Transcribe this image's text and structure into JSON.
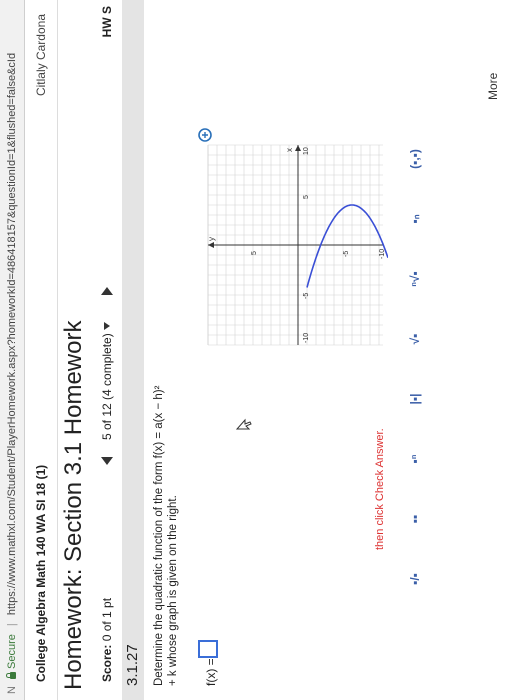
{
  "browser": {
    "secure_label": "Secure",
    "url": "https://www.mathxl.com/Student/PlayerHomework.aspx?homeworkId=48641815​7&questionId=1&flushed=false&cId"
  },
  "course": {
    "title": "College Algebra Math 140 WA SI 18 (1)",
    "user": "Citlaly Cardona"
  },
  "homework": {
    "title": "Homework: Section 3.1 Homework",
    "score_label": "Score:",
    "score_value": "0 of 1 pt",
    "progress": "5 of 12 (4 complete)",
    "right_label": "HW S"
  },
  "question": {
    "number": "3.1.27",
    "text": "Determine the quadratic function of the form f(x) = a(x − h)² + k whose graph is given on the right.",
    "answer_label": "f(x) ="
  },
  "graph": {
    "x_tick_labels": [
      "-10",
      "-5",
      "5",
      "10"
    ],
    "y_tick_labels": [
      "5",
      "-5",
      "-10"
    ],
    "x_axis_label": "x",
    "y_axis_label": "y",
    "curve_color": "#3a4fd6"
  },
  "footer": {
    "instruction": "then click Check Answer.",
    "more_label": "More"
  },
  "icons": [
    "lock-icon",
    "zoom-icon",
    "prev-arrow-icon",
    "next-arrow-icon",
    "cursor-icon"
  ]
}
